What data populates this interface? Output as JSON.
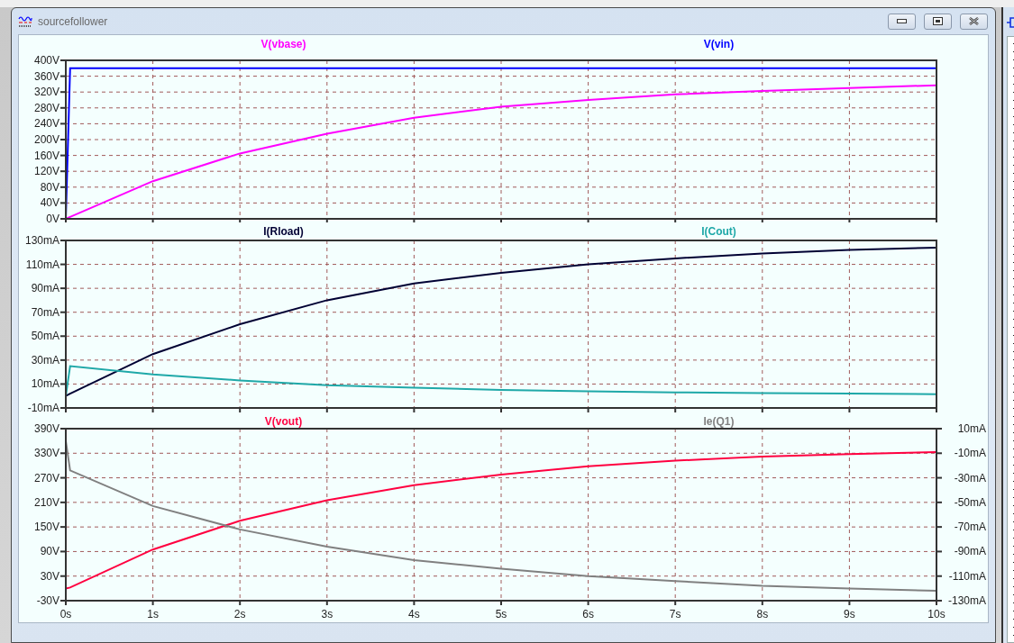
{
  "window": {
    "title": "sourcefollower"
  },
  "plots": [
    {
      "chart_data": {
        "type": "line",
        "grid": true,
        "x": [
          0,
          0.05,
          1,
          2,
          3,
          4,
          5,
          6,
          7,
          8,
          9,
          10
        ],
        "xlim": [
          0,
          10
        ],
        "ylim": [
          0,
          400
        ],
        "yticks": [
          {
            "value": 0,
            "label": "0V"
          },
          {
            "value": 40,
            "label": "40V"
          },
          {
            "value": 80,
            "label": "80V"
          },
          {
            "value": 120,
            "label": "120V"
          },
          {
            "value": 160,
            "label": "160V"
          },
          {
            "value": 200,
            "label": "200V"
          },
          {
            "value": 240,
            "label": "240V"
          },
          {
            "value": 280,
            "label": "280V"
          },
          {
            "value": 320,
            "label": "320V"
          },
          {
            "value": 360,
            "label": "360V"
          },
          {
            "value": 400,
            "label": "400V"
          }
        ],
        "series": [
          {
            "name": "V(vbase)",
            "color": "#ff00ff",
            "values": [
              0,
              5,
              95,
              165,
              215,
              255,
              283,
              300,
              314,
              323,
              330,
              337
            ]
          },
          {
            "name": "V(vin)",
            "color": "#0000ff",
            "values": [
              0,
              380,
              380,
              380,
              380,
              380,
              380,
              380,
              380,
              380,
              380,
              380
            ]
          }
        ]
      }
    },
    {
      "chart_data": {
        "type": "line",
        "grid": true,
        "x": [
          0,
          0.05,
          1,
          2,
          3,
          4,
          5,
          6,
          7,
          8,
          9,
          10
        ],
        "xlim": [
          0,
          10
        ],
        "ylim": [
          -10,
          130
        ],
        "yticks": [
          {
            "value": -10,
            "label": "-10mA"
          },
          {
            "value": 10,
            "label": "10mA"
          },
          {
            "value": 30,
            "label": "30mA"
          },
          {
            "value": 50,
            "label": "50mA"
          },
          {
            "value": 70,
            "label": "70mA"
          },
          {
            "value": 90,
            "label": "90mA"
          },
          {
            "value": 110,
            "label": "110mA"
          },
          {
            "value": 130,
            "label": "130mA"
          }
        ],
        "series": [
          {
            "name": "I(Rload)",
            "color": "#000033",
            "values": [
              0,
              2,
              35,
              60,
              80,
              94,
              103,
              110,
              115,
              119,
              122,
              124
            ]
          },
          {
            "name": "I(Cout)",
            "color": "#1fa8a8",
            "values": [
              0,
              25,
              18,
              13,
              9,
              7,
              5,
              4,
              3,
              2.5,
              2,
              1.5
            ]
          }
        ]
      }
    },
    {
      "chart_data": {
        "type": "line",
        "grid": true,
        "x": [
          0,
          0.05,
          1,
          2,
          3,
          4,
          5,
          6,
          7,
          8,
          9,
          10
        ],
        "xlim": [
          0,
          10
        ],
        "xticks": [
          {
            "value": 0,
            "label": "0s"
          },
          {
            "value": 1,
            "label": "1s"
          },
          {
            "value": 2,
            "label": "2s"
          },
          {
            "value": 3,
            "label": "3s"
          },
          {
            "value": 4,
            "label": "4s"
          },
          {
            "value": 5,
            "label": "5s"
          },
          {
            "value": 6,
            "label": "6s"
          },
          {
            "value": 7,
            "label": "7s"
          },
          {
            "value": 8,
            "label": "8s"
          },
          {
            "value": 9,
            "label": "9s"
          },
          {
            "value": 10,
            "label": "10s"
          }
        ],
        "ylim": [
          -30,
          390
        ],
        "yticks": [
          {
            "value": -30,
            "label": "-30V"
          },
          {
            "value": 30,
            "label": "30V"
          },
          {
            "value": 90,
            "label": "90V"
          },
          {
            "value": 150,
            "label": "150V"
          },
          {
            "value": 210,
            "label": "210V"
          },
          {
            "value": 270,
            "label": "270V"
          },
          {
            "value": 330,
            "label": "330V"
          },
          {
            "value": 390,
            "label": "390V"
          }
        ],
        "y2lim": [
          -130,
          10
        ],
        "y2ticks": [
          {
            "value": 10,
            "label": "10mA"
          },
          {
            "value": -10,
            "label": "-10mA"
          },
          {
            "value": -30,
            "label": "-30mA"
          },
          {
            "value": -50,
            "label": "-50mA"
          },
          {
            "value": -70,
            "label": "-70mA"
          },
          {
            "value": -90,
            "label": "-90mA"
          },
          {
            "value": -110,
            "label": "-110mA"
          },
          {
            "value": -130,
            "label": "-130mA"
          }
        ],
        "series": [
          {
            "name": "V(vout)",
            "color": "#ff0040",
            "values": [
              0,
              2,
              95,
              165,
              215,
              252,
              278,
              298,
              312,
              322,
              328,
              333
            ]
          },
          {
            "name": "Ie(Q1)",
            "color": "#808080",
            "axis": "y2",
            "values": [
              0,
              -24,
              -53,
              -72,
              -86,
              -97,
              -104,
              -110,
              -114,
              -118,
              -120,
              -122
            ]
          }
        ]
      }
    }
  ]
}
